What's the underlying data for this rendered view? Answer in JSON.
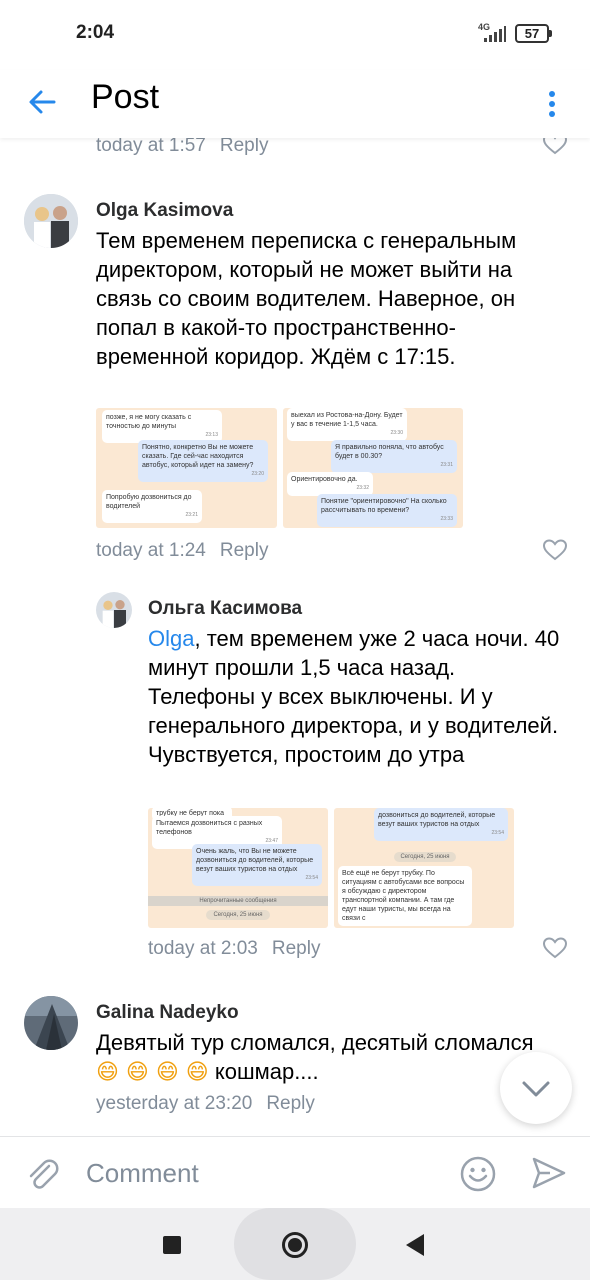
{
  "status_bar": {
    "time": "2:04",
    "network": "4G",
    "battery": "57"
  },
  "header": {
    "title": "Post"
  },
  "comments": [
    {
      "time": "today at 1:57",
      "reply": "Reply"
    },
    {
      "author": "Olga Kasimova",
      "text": "Тем временем переписка с генеральным директором, который не может выйти на связь со своим водителем. Наверное, он попал в какой-то пространственно-временной коридор. Ждём с 17:15.",
      "time": "today at 1:24",
      "reply": "Reply",
      "screenshots": [
        {
          "messages": [
            {
              "text": "позже, я не могу сказать с точностью до минуты",
              "time": "23:13"
            },
            {
              "text": "Понятно, конкретно Вы не можете сказать. Где сей-час находится автобус, который идет на замену?",
              "time": "23:20"
            },
            {
              "text": "Попробую дозвониться до водителей",
              "time": "23:21"
            }
          ]
        },
        {
          "messages": [
            {
              "text": "выехал из Ростова-на-Дону. Будет у вас в течение 1-1,5 часа.",
              "time": "23:30"
            },
            {
              "text": "Я правильно поняла, что автобус будет в 00.30?",
              "time": "23:31"
            },
            {
              "text": "Ориентировочно да.",
              "time": "23:32"
            },
            {
              "text": "Понятие \"ориентировочно\" На сколько рассчитывать по времени?",
              "time": "23:33"
            }
          ]
        }
      ]
    },
    {
      "author": "Ольга Касимова",
      "mention": "Olga",
      "text": ", тем временем уже 2 часа ночи. 40 минут прошли 1,5 часа назад. Телефоны у всех выключены. И у генерального директора, и у водителей. Чувствуется, простоим до утра",
      "time": "today at 2:03",
      "reply": "Reply",
      "screenshots": [
        {
          "messages": [
            {
              "text": "трубку не берут пока",
              "time": ""
            },
            {
              "text": "Пытаемся дозвониться с разных телефонов",
              "time": "23:47"
            },
            {
              "text": "Очень жаль, что Вы не можете дозвониться до водителей, которые везут ваших туристов на отдых",
              "time": "23:54"
            },
            {
              "text": "Непрочитанные сообщения",
              "time": ""
            },
            {
              "text": "Сегодня, 25 июня",
              "time": ""
            }
          ]
        },
        {
          "messages": [
            {
              "text": "дозвониться до водителей, которые везут ваших туристов на отдых",
              "time": "23:54"
            },
            {
              "text": "Сегодня, 25 июня",
              "time": ""
            },
            {
              "text": "Всё ещё не берут трубку. По ситуациям с автобусами все вопросы я обсуждаю с директором транспортной компании. А там где едут наши туристы, мы всегда на связи с",
              "time": ""
            }
          ]
        }
      ]
    },
    {
      "author": "Galina Nadeyko",
      "text": "Девятый тур сломался, десятый сломался",
      "emoji": "😄 😄 😄 😄",
      "text2": "кошмар....",
      "time": "yesterday at 23:20",
      "reply": "Reply"
    }
  ],
  "composer": {
    "placeholder": "Comment"
  },
  "colors": {
    "accent": "#2688eb",
    "meta": "#818c99",
    "screenshot_bg": "#fbe8d3"
  },
  "icons": [
    "back-arrow-icon",
    "more-vertical-icon",
    "heart-icon",
    "chevron-down-icon",
    "paperclip-icon",
    "smile-icon",
    "send-icon"
  ]
}
